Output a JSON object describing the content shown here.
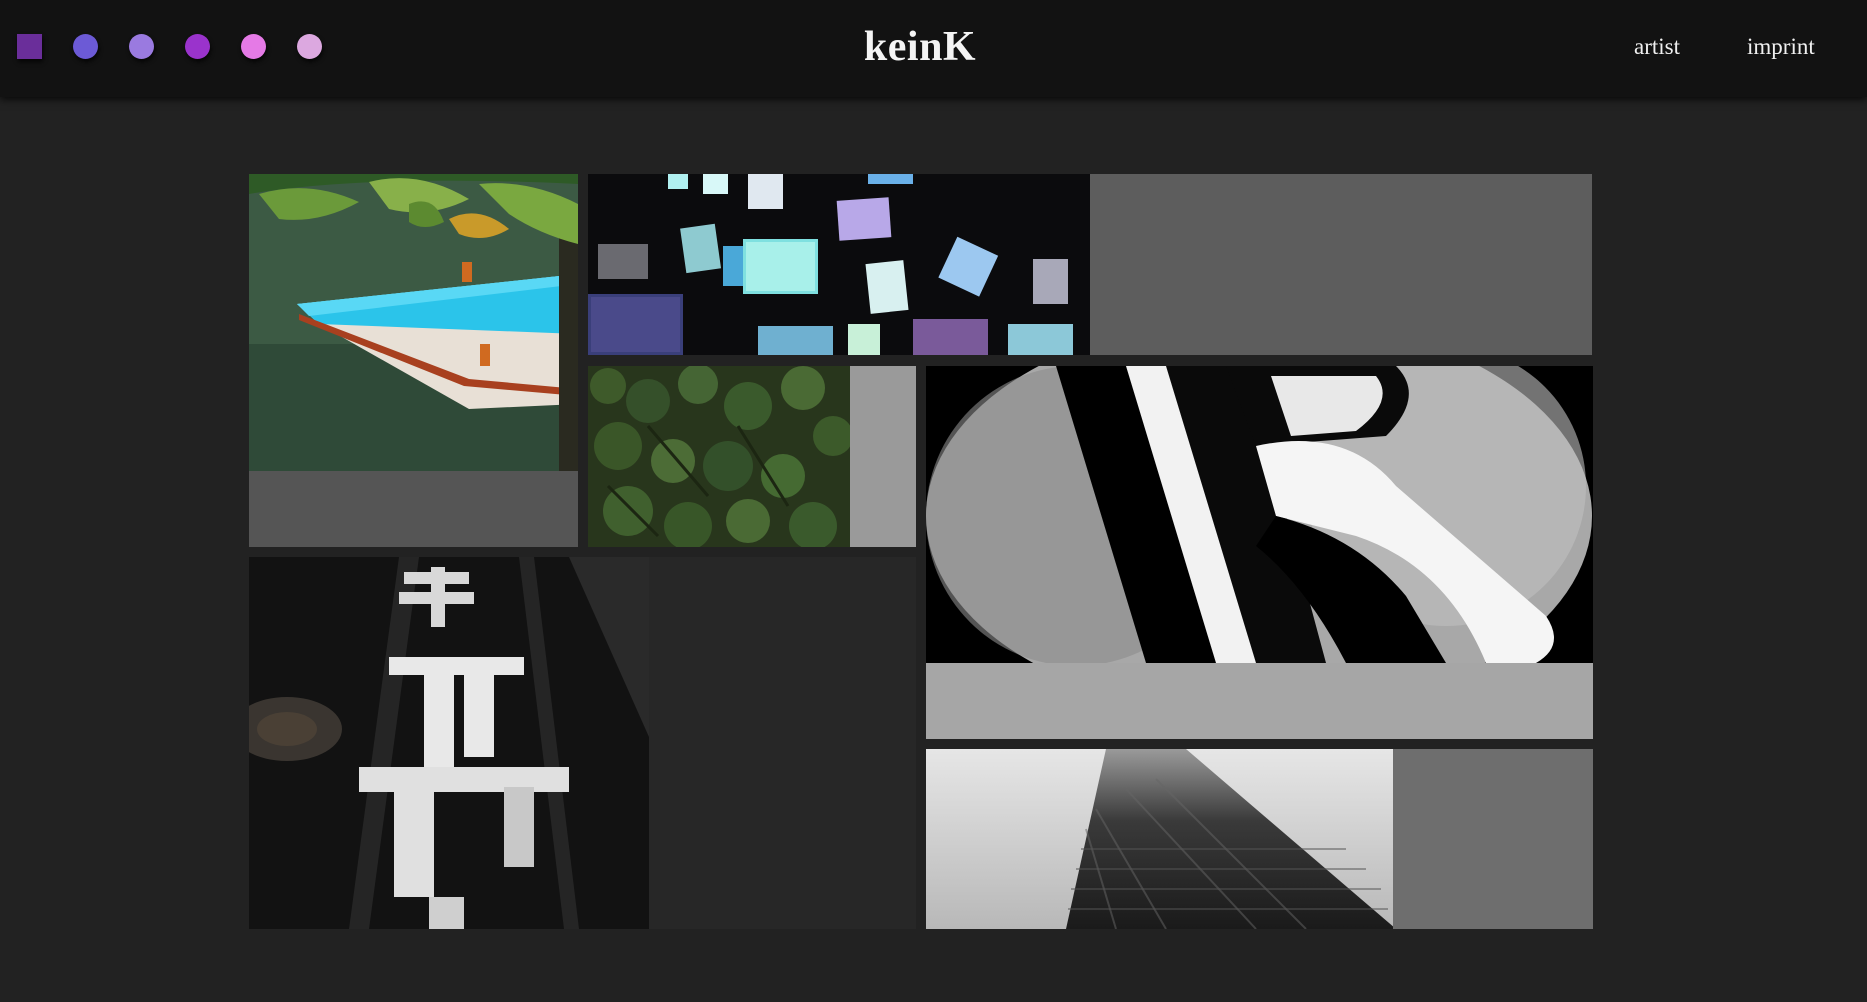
{
  "header": {
    "brand": "keinK",
    "nav": {
      "artist": "artist",
      "imprint": "imprint"
    },
    "swatches": [
      {
        "name": "swatch-purple-square",
        "color": "#6a2e9a"
      },
      {
        "name": "swatch-blue-violet",
        "color": "#6c5ad6"
      },
      {
        "name": "swatch-lavender",
        "color": "#9a7ae0"
      },
      {
        "name": "swatch-violet",
        "color": "#9a33cc"
      },
      {
        "name": "swatch-pink",
        "color": "#e57ae6"
      },
      {
        "name": "swatch-light-pink",
        "color": "#dca8e0"
      }
    ]
  },
  "gallery": {
    "background": "#222222",
    "tiles": [
      {
        "name": "boat-photo",
        "subject": "turquoise boat on green water"
      },
      {
        "name": "tv-screens-photo",
        "subject": "stack of glowing television screens"
      },
      {
        "name": "forest-photo",
        "subject": "aerial view of treetops"
      },
      {
        "name": "letter-k-artwork",
        "subject": "black and white letter K"
      },
      {
        "name": "street-markings-photo",
        "subject": "white road markings on asphalt"
      },
      {
        "name": "skyscraper-photo",
        "subject": "skyscraper in fog"
      }
    ]
  }
}
